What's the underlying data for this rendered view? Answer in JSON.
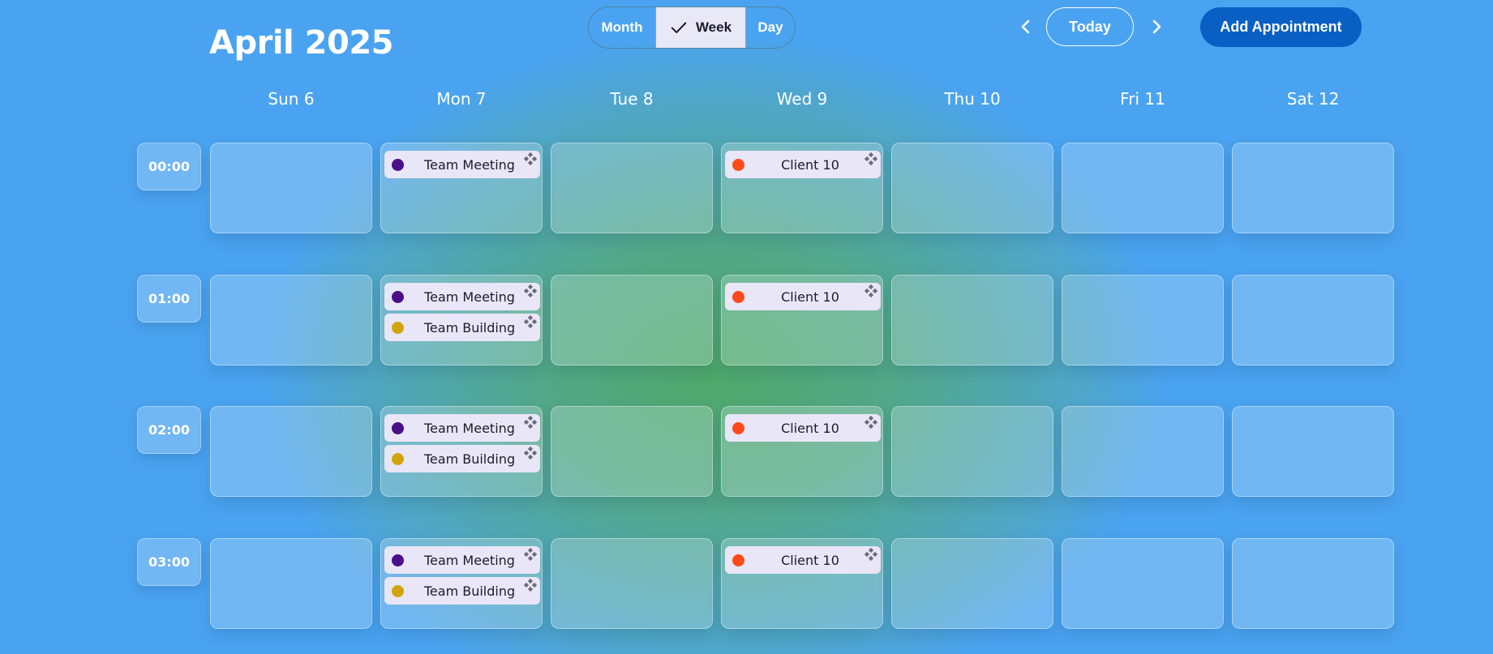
{
  "header": {
    "title": "April 2025",
    "views": [
      "Month",
      "Week",
      "Day"
    ],
    "active_view": "Week",
    "today_label": "Today",
    "add_label": "Add Appointment"
  },
  "days": [
    "Sun 6",
    "Mon 7",
    "Tue 8",
    "Wed 9",
    "Thu 10",
    "Fri 11",
    "Sat 12"
  ],
  "times": [
    "00:00",
    "01:00",
    "02:00",
    "03:00"
  ],
  "event_colors": {
    "Team Meeting": "#4b0f8a",
    "Team Building": "#d1a50a",
    "Client 10": "#ff4a1a"
  },
  "appointments": [
    {
      "day": 1,
      "slot": 0,
      "title": "Team Meeting"
    },
    {
      "day": 3,
      "slot": 0,
      "title": "Client 10"
    },
    {
      "day": 1,
      "slot": 1,
      "title": "Team Meeting"
    },
    {
      "day": 1,
      "slot": 1,
      "title": "Team Building"
    },
    {
      "day": 3,
      "slot": 1,
      "title": "Client 10"
    },
    {
      "day": 1,
      "slot": 2,
      "title": "Team Meeting"
    },
    {
      "day": 1,
      "slot": 2,
      "title": "Team Building"
    },
    {
      "day": 3,
      "slot": 2,
      "title": "Client 10"
    },
    {
      "day": 1,
      "slot": 3,
      "title": "Team Meeting"
    },
    {
      "day": 1,
      "slot": 3,
      "title": "Team Building"
    },
    {
      "day": 3,
      "slot": 3,
      "title": "Client 10"
    }
  ]
}
